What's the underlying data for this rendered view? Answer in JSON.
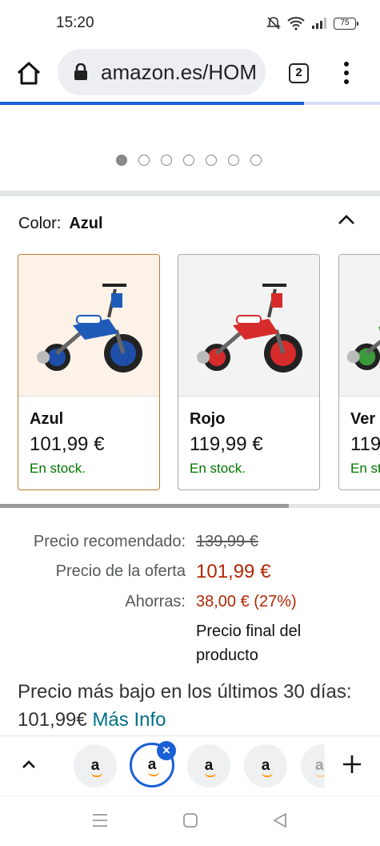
{
  "status": {
    "time": "15:20",
    "battery": "75"
  },
  "browser": {
    "url": "amazon.es/HOM",
    "tab_count": "2",
    "load_progress": 0.8
  },
  "carousel": {
    "total": 7,
    "active": 0
  },
  "color": {
    "label": "Color:",
    "selected": "Azul",
    "swatches": [
      {
        "name": "Azul",
        "price": "101,99 €",
        "stock": "En stock.",
        "accent": "#1e5bb8"
      },
      {
        "name": "Rojo",
        "price": "119,99 €",
        "stock": "En stock.",
        "accent": "#d62b2b"
      },
      {
        "name": "Ver",
        "price": "119",
        "stock": "En st",
        "accent": "#3b9a3b"
      }
    ]
  },
  "pricing": {
    "list_label": "Precio recomendado:",
    "list_value": "139,99 €",
    "offer_label": "Precio de la oferta",
    "offer_value": "101,99 €",
    "save_label": "Ahorras:",
    "save_value": "38,00 € (27%)",
    "final_note": "Precio final del producto",
    "lowest_text": "Precio más bajo en los últimos 30 días: 101,99€",
    "lowest_link": "Más Info"
  },
  "tabstrip": {
    "tab_glyph": "a",
    "close_glyph": "×"
  },
  "colors": {
    "accent_blue": "#1a5fd6",
    "price_red": "#b12704",
    "stock_green": "#007600",
    "link_teal": "#007185",
    "selected_border": "#c07a2a"
  }
}
